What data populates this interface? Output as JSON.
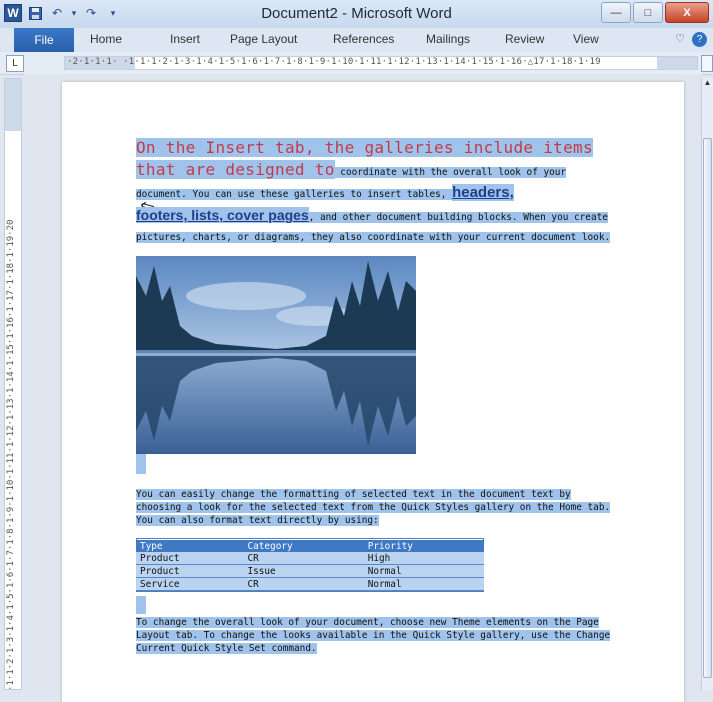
{
  "window": {
    "title": "Document2 - Microsoft Word",
    "app_icon": "W",
    "minimize": "—",
    "maximize": "□",
    "close": "X"
  },
  "qat": {
    "save": "save-icon",
    "undo": "↶",
    "undo_dropdown": "▾",
    "redo": "↷",
    "customize": "▾"
  },
  "ribbon": {
    "file": "File",
    "tabs": [
      "Home",
      "Insert",
      "Page Layout",
      "References",
      "Mailings",
      "Review",
      "View"
    ],
    "collapse": "♡",
    "help": "?"
  },
  "ruler": {
    "toggle": "L",
    "horizontal": "·2·1·1·1· ·1·1·1·2·1·3·1·4·1·5·1·6·1·7·1·8·1·9·1·10·1·11·1·12·1·13·1·14·1·15·1·16·△17·1·18·1·19",
    "vertical": "·1·1·2·1·3·1·4·1·5·1·6·1·7·1·8·1·9·1·10·1·11·1·12·1·13·1·14·1·15·1·16·1·17·1·18·1·19·20"
  },
  "document": {
    "p1_big": "On the Insert tab, the galleries include items that are designed to",
    "p1_a": " coordinate with the overall look of your document. You can use these galleries to insert tables, ",
    "p1_link1": "headers,",
    "p1_link2": "footers, lists, cover pages",
    "p1_b": ", and other document building blocks. When you create pictures, charts, or diagrams, they also coordinate with your current document look.",
    "p2": "You can easily change the formatting of selected text in the document text by choosing a look for the selected text from the Quick Styles gallery on the Home tab. You can also format text directly by using:",
    "table": {
      "headers": [
        "Type",
        "Category",
        "Priority"
      ],
      "rows": [
        [
          "Product",
          "CR",
          "High"
        ],
        [
          "Product",
          "Issue",
          "Normal"
        ],
        [
          "Service",
          "CR",
          "Normal"
        ]
      ]
    },
    "p3": "To change the overall look of your document, choose new Theme elements on the Page Layout tab. To change the looks available in the Quick Style gallery, use the Change Current Quick Style Set command."
  },
  "colors": {
    "selection": "#9fc3ea",
    "heading_red": "#c23b4a",
    "link_blue": "#1f3f8c",
    "table_header": "#3f78c3"
  }
}
